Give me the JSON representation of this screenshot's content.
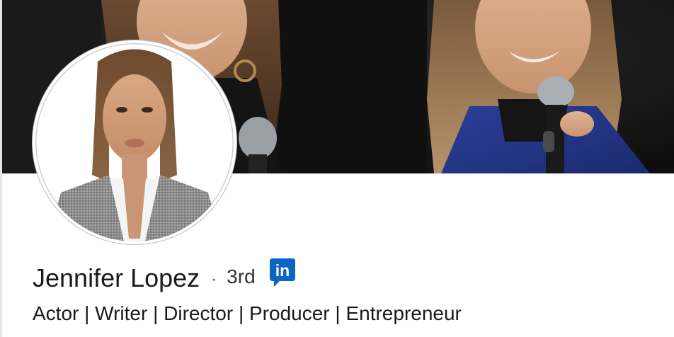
{
  "profile": {
    "name": "Jennifer Lopez",
    "separator": "·",
    "connection_degree": "3rd",
    "headline": "Actor | Writer | Director | Producer | Entrepreneur"
  },
  "badge": {
    "icon": "linkedin-logo-icon",
    "text": "in",
    "color": "#0a66c2"
  },
  "banner": {
    "description_icon": "banner-photo"
  },
  "colors": {
    "name_text": "#1a1a1a",
    "background": "#ffffff",
    "linkedin_blue": "#0a66c2"
  }
}
